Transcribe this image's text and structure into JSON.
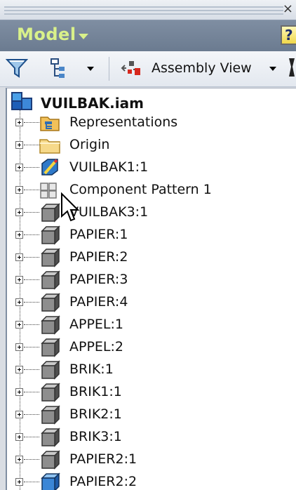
{
  "panel": {
    "title": "Model",
    "help_label": "?"
  },
  "toolbar": {
    "filter_icon": "filter-icon",
    "tree_icon": "tree-structure-icon",
    "view_label": "Assembly View"
  },
  "tree": {
    "root": {
      "label": "VUILBAK.iam",
      "icon": "assembly-icon"
    },
    "items": [
      {
        "label": "Representations",
        "icon": "representations-icon"
      },
      {
        "label": "Origin",
        "icon": "folder-icon"
      },
      {
        "label": "VUILBAK1:1",
        "icon": "edit-part-icon"
      },
      {
        "label": "Component Pattern 1",
        "icon": "component-pattern-icon"
      },
      {
        "label": "VUILBAK3:1",
        "icon": "part-icon"
      },
      {
        "label": "PAPIER:1",
        "icon": "part-icon"
      },
      {
        "label": "PAPIER:2",
        "icon": "part-icon"
      },
      {
        "label": "PAPIER:3",
        "icon": "part-icon"
      },
      {
        "label": "PAPIER:4",
        "icon": "part-icon"
      },
      {
        "label": "APPEL:1",
        "icon": "part-icon"
      },
      {
        "label": "APPEL:2",
        "icon": "part-icon"
      },
      {
        "label": "BRIK:1",
        "icon": "part-icon"
      },
      {
        "label": "BRIK1:1",
        "icon": "part-icon"
      },
      {
        "label": "BRIK2:1",
        "icon": "part-icon"
      },
      {
        "label": "BRIK3:1",
        "icon": "part-icon"
      },
      {
        "label": "PAPIER2:1",
        "icon": "part-icon"
      },
      {
        "label": "PAPIER2:2",
        "icon": "blue-part-icon"
      }
    ]
  }
}
